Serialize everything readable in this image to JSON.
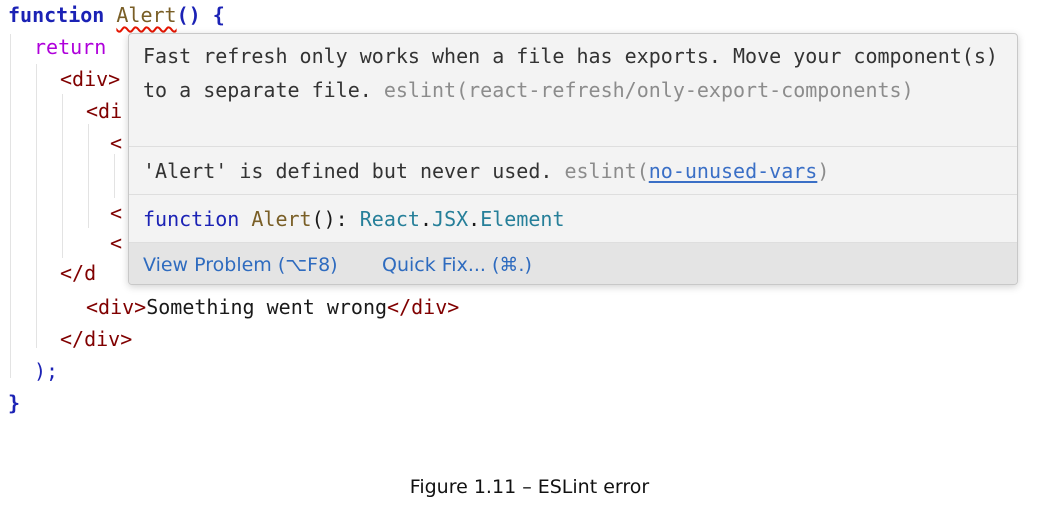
{
  "code": {
    "line1": {
      "keyword": "function",
      "name": "Alert",
      "rest": "() {"
    },
    "line2": {
      "text": "return"
    },
    "line3": {
      "text": "<div>"
    },
    "line4": {
      "text": "<di"
    },
    "line5": {
      "text": "<"
    },
    "line7": {
      "text": "<"
    },
    "line8": {
      "text": "<"
    },
    "line9": {
      "text": "</d"
    },
    "line10": {
      "open": "<div>",
      "content": "Something went wrong",
      "close": "</div>"
    },
    "line11": {
      "text": "</div>"
    },
    "line12": {
      "text": ");"
    },
    "line13": {
      "text": "}"
    }
  },
  "hover": {
    "problem1": {
      "message": "Fast refresh only works when a file has exports. Move your component(s) to a separate file.",
      "source": "eslint(react-refresh/only-export-components)"
    },
    "problem2": {
      "message": "'Alert' is defined but never used.",
      "source_prefix": "eslint(",
      "rule": "no-unused-vars",
      "source_suffix": ")"
    },
    "signature": {
      "keyword": "function",
      "name": "Alert",
      "params": "():",
      "type_ns1": "React",
      "dot1": ".",
      "type_ns2": "JSX",
      "dot2": ".",
      "type_name": "Element"
    },
    "actions": {
      "view_problem": "View Problem (⌥F8)",
      "quick_fix": "Quick Fix... (⌘.)"
    }
  },
  "caption": "Figure 1.11 – ESLint error"
}
